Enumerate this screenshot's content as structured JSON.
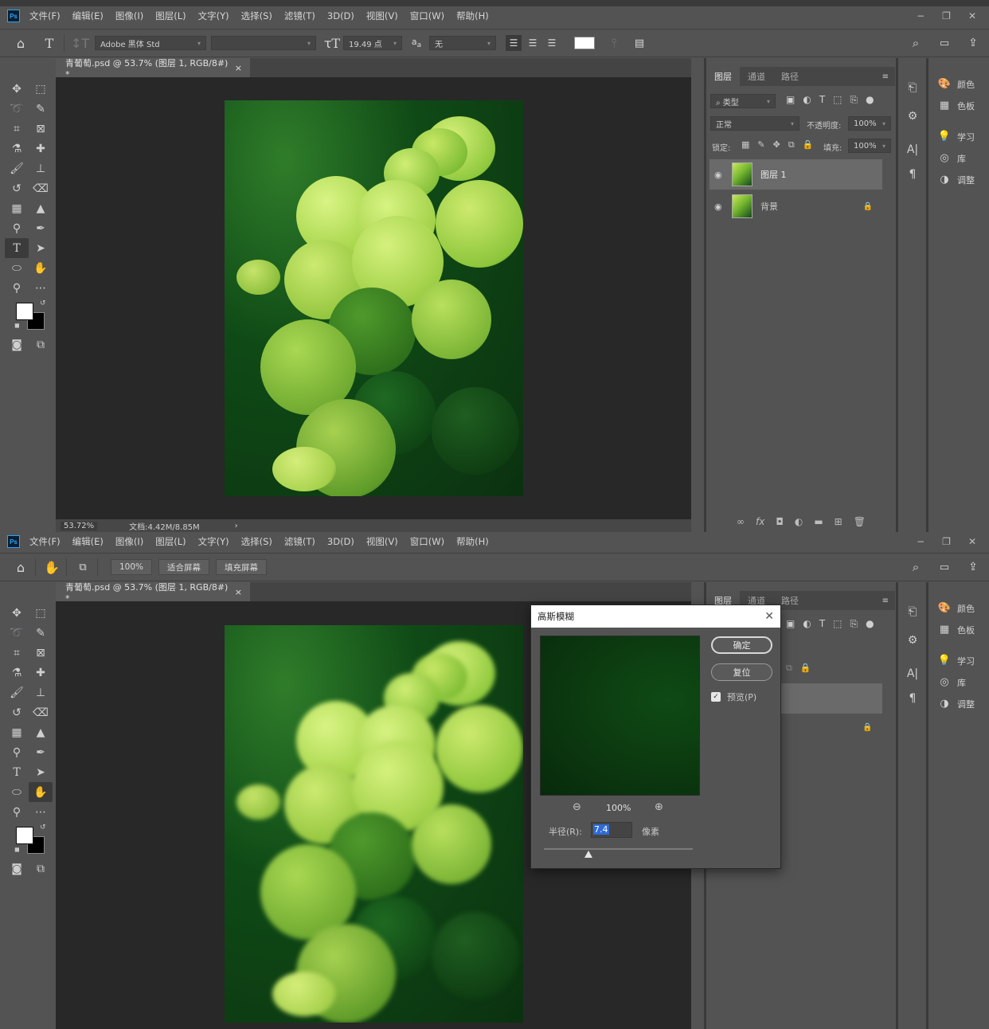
{
  "menu": [
    "文件(F)",
    "编辑(E)",
    "图像(I)",
    "图层(L)",
    "文字(Y)",
    "选择(S)",
    "滤镜(T)",
    "3D(D)",
    "视图(V)",
    "窗口(W)",
    "帮助(H)"
  ],
  "window_controls": {
    "minimize": "−",
    "restore": "❐",
    "close": "✕"
  },
  "options_text": {
    "font_family": "Adobe 黑体 Std",
    "font_size": "19.49 点",
    "aa_label": "a",
    "aa_mode": "无"
  },
  "options_hand": {
    "zoom": "100%",
    "fit_screen": "适合屏幕",
    "fill_screen": "填充屏幕"
  },
  "doc_tab": {
    "title": "青葡萄.psd @ 53.7% (图层 1, RGB/8#) *",
    "close": "×"
  },
  "status": {
    "zoom": "53.72%",
    "doc_size": "文档:4.42M/8.85M",
    "arrow": "›"
  },
  "layers_panel": {
    "tabs": [
      "图层",
      "通道",
      "路径"
    ],
    "filter": "类型",
    "blend_mode": "正常",
    "opacity_label": "不透明度:",
    "opacity": "100%",
    "lock_label": "锁定:",
    "fill_label": "填充:",
    "fill": "100%",
    "layers": [
      {
        "name": "图层 1"
      },
      {
        "name": "背景"
      }
    ]
  },
  "right_panel": [
    {
      "icon": "palette-icon",
      "label": "颜色"
    },
    {
      "icon": "swatches-icon",
      "label": "色板"
    },
    {
      "icon": "bulb-icon",
      "label": "学习"
    },
    {
      "icon": "library-icon",
      "label": "库"
    },
    {
      "icon": "adjust-icon",
      "label": "调整"
    }
  ],
  "gaussian": {
    "title": "高斯模糊",
    "ok": "确定",
    "reset": "复位",
    "preview": "预览(P)",
    "zoom": "100%",
    "radius_label": "半径(R):",
    "radius": "7.4",
    "unit": "像素",
    "slider_fraction": 0.3
  }
}
